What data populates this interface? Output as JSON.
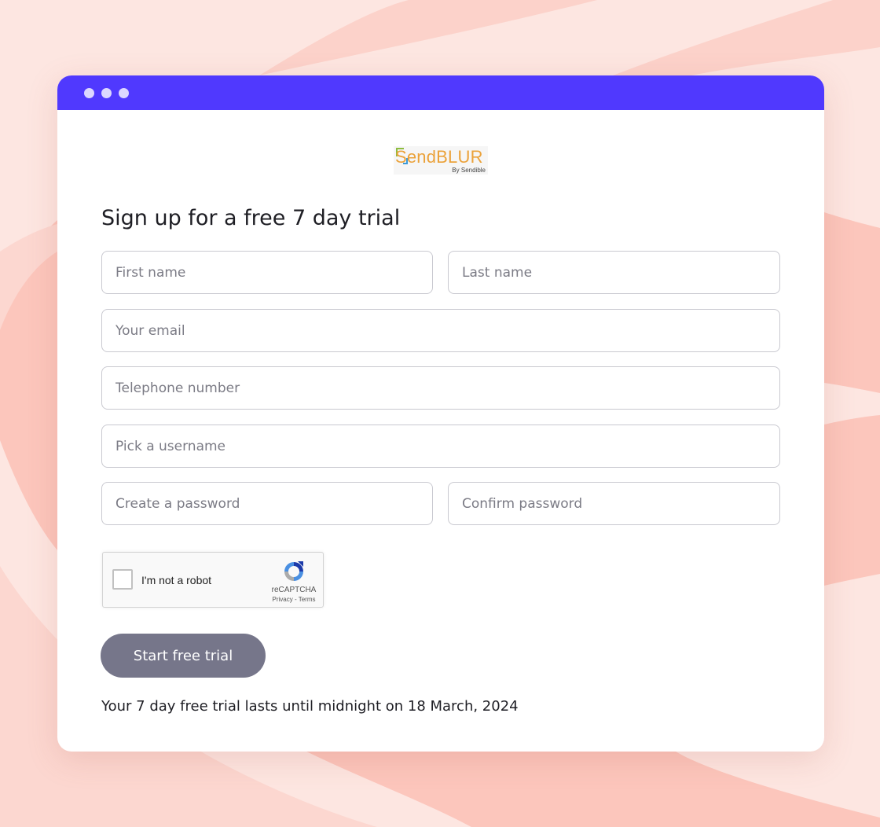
{
  "logo": {
    "text": "SendBLUR",
    "subtext": "By Sendible"
  },
  "form": {
    "heading": "Sign up for a free 7 day trial",
    "first_name_placeholder": "First name",
    "last_name_placeholder": "Last name",
    "email_placeholder": "Your email",
    "phone_placeholder": "Telephone number",
    "username_placeholder": "Pick a username",
    "password_placeholder": "Create a password",
    "confirm_password_placeholder": "Confirm password"
  },
  "captcha": {
    "label": "I'm not a robot",
    "brand": "reCAPTCHA",
    "links": "Privacy - Terms"
  },
  "cta_label": "Start free trial",
  "trial_note": "Your 7 day free trial lasts until midnight on 18 March, 2024",
  "colors": {
    "titlebar": "#5039fe",
    "cta": "#76768a",
    "background": "#fde6e1",
    "logo_text": "#eba23a"
  },
  "icons": [
    "window-dot-icon",
    "recaptcha-icon",
    "logo-bracket-icon"
  ]
}
